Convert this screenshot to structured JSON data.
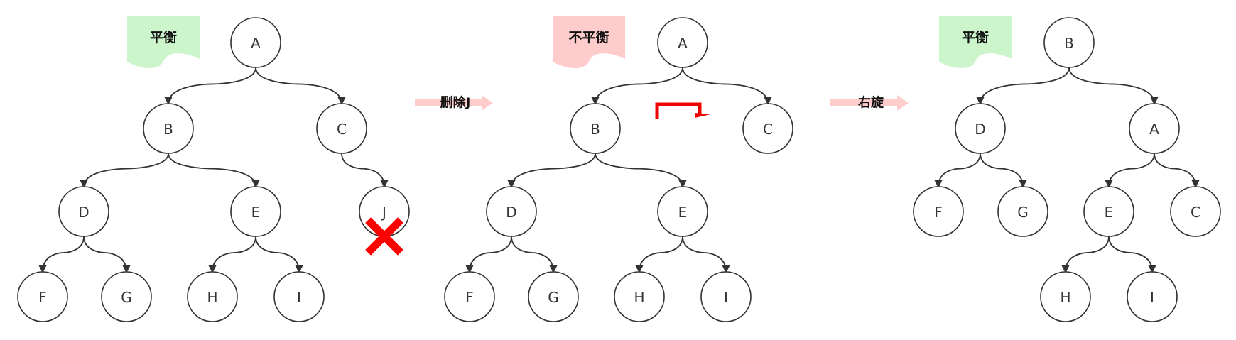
{
  "colors": {
    "balanced_fill": "#ccf5cc",
    "unbalanced_fill": "#ffcccc",
    "arrow_fill": "#ffcccc",
    "delete_mark": "#ff0000",
    "rotate_mark": "#ee0000"
  },
  "panels": [
    {
      "status": "平衡",
      "status_kind": "balanced",
      "nodes": [
        "A",
        "B",
        "C",
        "D",
        "E",
        "J",
        "F",
        "G",
        "H",
        "I"
      ],
      "edges": [
        [
          "A",
          "B"
        ],
        [
          "A",
          "C"
        ],
        [
          "B",
          "D"
        ],
        [
          "B",
          "E"
        ],
        [
          "C",
          "J"
        ],
        [
          "D",
          "F"
        ],
        [
          "D",
          "G"
        ],
        [
          "E",
          "H"
        ],
        [
          "E",
          "I"
        ]
      ],
      "deleted": "J"
    },
    {
      "status": "不平衡",
      "status_kind": "unbalanced",
      "nodes": [
        "A",
        "B",
        "C",
        "D",
        "E",
        "F",
        "G",
        "H",
        "I"
      ],
      "edges": [
        [
          "A",
          "B"
        ],
        [
          "A",
          "C"
        ],
        [
          "B",
          "D"
        ],
        [
          "B",
          "E"
        ],
        [
          "D",
          "F"
        ],
        [
          "D",
          "G"
        ],
        [
          "E",
          "H"
        ],
        [
          "E",
          "I"
        ]
      ],
      "rotate_icon": "rotate-right-icon"
    },
    {
      "status": "平衡",
      "status_kind": "balanced",
      "nodes": [
        "B",
        "D",
        "A",
        "F",
        "G",
        "E",
        "C",
        "H",
        "I"
      ],
      "edges": [
        [
          "B",
          "D"
        ],
        [
          "B",
          "A"
        ],
        [
          "D",
          "F"
        ],
        [
          "D",
          "G"
        ],
        [
          "A",
          "E"
        ],
        [
          "A",
          "C"
        ],
        [
          "E",
          "H"
        ],
        [
          "E",
          "I"
        ]
      ]
    }
  ],
  "operations": [
    "删除J",
    "右旋"
  ],
  "icons": [
    "delete-x-icon",
    "rotate-right-icon",
    "arrow-right-icon"
  ]
}
